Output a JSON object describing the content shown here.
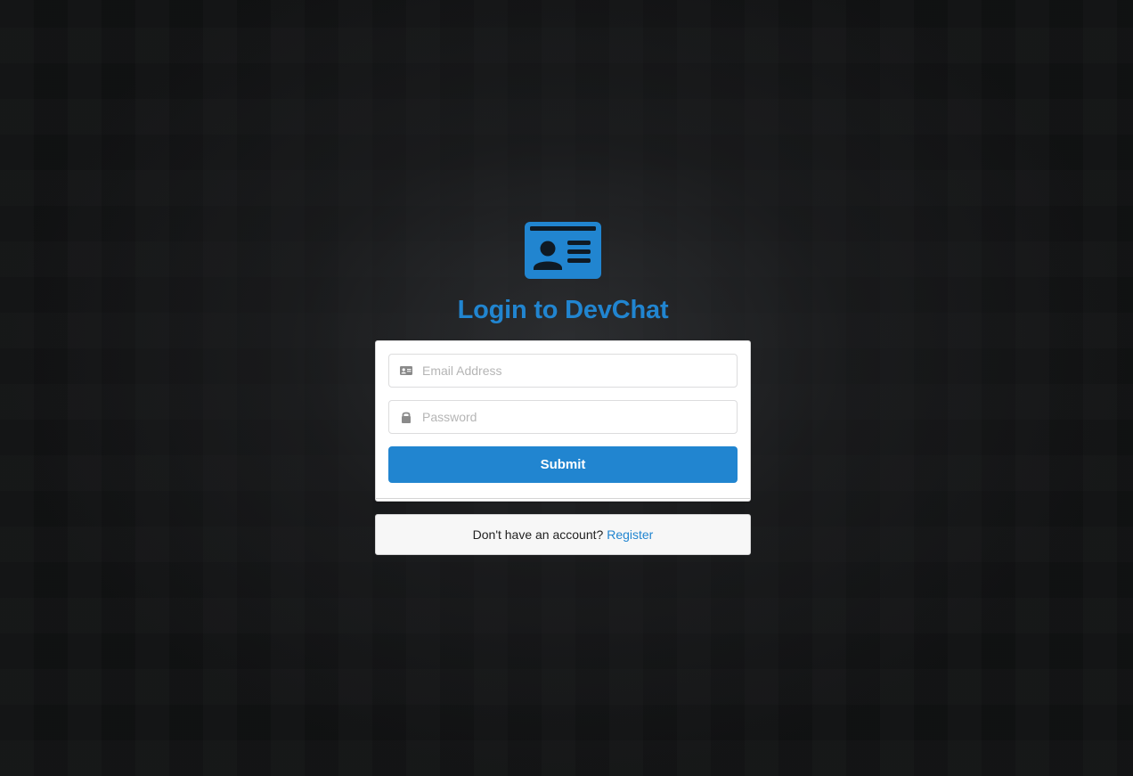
{
  "logo": {
    "icon": "id-card-icon",
    "color": "#2185d0"
  },
  "title": "Login to DevChat",
  "form": {
    "email": {
      "icon": "id-card-icon",
      "placeholder": "Email Address",
      "value": ""
    },
    "password": {
      "icon": "lock-icon",
      "placeholder": "Password",
      "value": ""
    },
    "submit_label": "Submit"
  },
  "register": {
    "prompt": "Don't have an account?",
    "link_label": "Register"
  },
  "colors": {
    "accent": "#2185d0",
    "background": "#111213"
  }
}
